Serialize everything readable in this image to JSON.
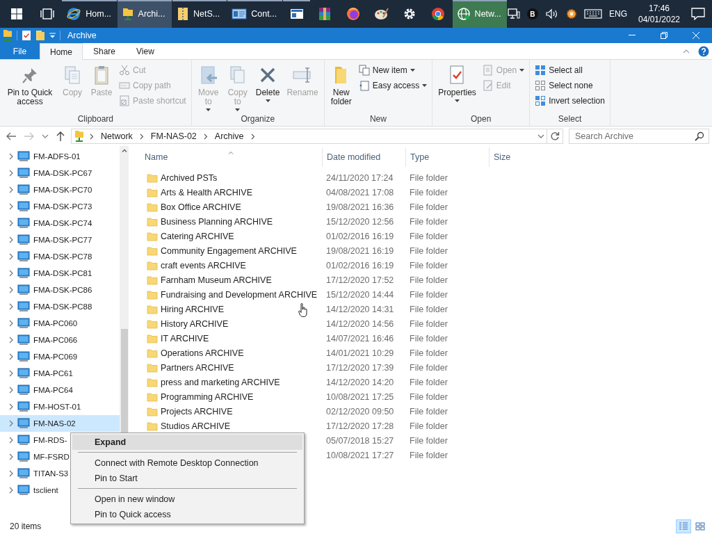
{
  "taskbar": {
    "apps": [
      {
        "kind": "start",
        "selected": false,
        "running": false
      },
      {
        "kind": "taskview",
        "selected": false,
        "running": false
      },
      {
        "kind": "ie",
        "label": "Hom...",
        "selected": false,
        "running": true
      },
      {
        "kind": "explorer",
        "label": "Archi...",
        "selected": true,
        "running": true
      },
      {
        "kind": "zip",
        "label": "NetS...",
        "selected": false,
        "running": true
      },
      {
        "kind": "card",
        "label": "Cont...",
        "selected": false,
        "running": true
      },
      {
        "kind": "window",
        "selected": false,
        "running": true
      },
      {
        "kind": "books",
        "selected": false,
        "running": false
      },
      {
        "kind": "firefox",
        "selected": false,
        "running": false
      },
      {
        "kind": "palette",
        "selected": false,
        "running": false
      },
      {
        "kind": "gear",
        "selected": false,
        "running": false
      },
      {
        "kind": "chrome",
        "selected": false,
        "running": false
      },
      {
        "kind": "globe",
        "label": "Netw...",
        "selected": false,
        "running": true,
        "attention": true
      }
    ],
    "tray": [
      {
        "kind": "monitor"
      },
      {
        "kind": "badge",
        "label": "B"
      },
      {
        "kind": "speaker"
      },
      {
        "kind": "cog"
      },
      {
        "kind": "keyboard"
      }
    ],
    "language": "ENG",
    "time": "17:46",
    "date": "04/01/2022"
  },
  "window": {
    "title": "Archive"
  },
  "ribbon": {
    "tabs": [
      {
        "label": "File",
        "kind": "file",
        "selected": false
      },
      {
        "label": "Home",
        "kind": "tab",
        "selected": true
      },
      {
        "label": "Share",
        "kind": "tab",
        "selected": false
      },
      {
        "label": "View",
        "kind": "tab",
        "selected": false
      }
    ],
    "groups": [
      {
        "label": "Clipboard",
        "controls": [
          {
            "kind": "large",
            "label": "Pin to Quick access",
            "disabled": false
          },
          {
            "kind": "large",
            "label": "Copy",
            "disabled": true
          },
          {
            "kind": "large",
            "label": "Paste",
            "disabled": true
          },
          {
            "kind": "stack",
            "items": [
              {
                "label": "Cut",
                "disabled": true
              },
              {
                "label": "Copy path",
                "disabled": true
              },
              {
                "label": "Paste shortcut",
                "disabled": true
              }
            ]
          }
        ]
      },
      {
        "label": "Organize",
        "controls": [
          {
            "kind": "large",
            "label": "Move to",
            "disabled": true,
            "dropdown": true
          },
          {
            "kind": "large",
            "label": "Copy to",
            "disabled": true,
            "dropdown": true
          },
          {
            "kind": "large",
            "label": "Delete",
            "disabled": false,
            "dropdown": true
          },
          {
            "kind": "large",
            "label": "Rename",
            "disabled": true
          }
        ]
      },
      {
        "label": "New",
        "controls": [
          {
            "kind": "large",
            "label": "New folder",
            "disabled": false
          },
          {
            "kind": "stack",
            "items": [
              {
                "label": "New item",
                "disabled": false,
                "dropdown": true
              },
              {
                "label": "Easy access",
                "disabled": false,
                "dropdown": true
              }
            ]
          }
        ]
      },
      {
        "label": "Open",
        "controls": [
          {
            "kind": "large",
            "label": "Properties",
            "disabled": false,
            "dropdown": true
          },
          {
            "kind": "stack",
            "items": [
              {
                "label": "Open",
                "disabled": true,
                "dropdown": true
              },
              {
                "label": "Edit",
                "disabled": true
              }
            ]
          }
        ]
      },
      {
        "label": "Select",
        "controls": [
          {
            "kind": "stack",
            "items": [
              {
                "label": "Select all",
                "disabled": false
              },
              {
                "label": "Select none",
                "disabled": false
              },
              {
                "label": "Invert selection",
                "disabled": false
              }
            ]
          }
        ]
      }
    ]
  },
  "address": {
    "crumbs": [
      "Network",
      "FM-NAS-02",
      "Archive"
    ],
    "search_placeholder": "Search Archive"
  },
  "sidebar": {
    "items": [
      {
        "label": "FM-ADFS-01",
        "selected": false,
        "expanded": false
      },
      {
        "label": "FMA-DSK-PC67",
        "selected": false,
        "expanded": false
      },
      {
        "label": "FMA-DSK-PC70",
        "selected": false,
        "expanded": false
      },
      {
        "label": "FMA-DSK-PC73",
        "selected": false,
        "expanded": false
      },
      {
        "label": "FMA-DSK-PC74",
        "selected": false,
        "expanded": false
      },
      {
        "label": "FMA-DSK-PC77",
        "selected": false,
        "expanded": false
      },
      {
        "label": "FMA-DSK-PC78",
        "selected": false,
        "expanded": false
      },
      {
        "label": "FMA-DSK-PC81",
        "selected": false,
        "expanded": false
      },
      {
        "label": "FMA-DSK-PC86",
        "selected": false,
        "expanded": false
      },
      {
        "label": "FMA-DSK-PC88",
        "selected": false,
        "expanded": false
      },
      {
        "label": "FMA-PC060",
        "selected": false,
        "expanded": false
      },
      {
        "label": "FMA-PC066",
        "selected": false,
        "expanded": false
      },
      {
        "label": "FMA-PC069",
        "selected": false,
        "expanded": false
      },
      {
        "label": "FMA-PC61",
        "selected": false,
        "expanded": false
      },
      {
        "label": "FMA-PC64",
        "selected": false,
        "expanded": false
      },
      {
        "label": "FM-HOST-01",
        "selected": false,
        "expanded": false
      },
      {
        "label": "FM-NAS-02",
        "selected": true,
        "expanded": false
      },
      {
        "label": "FM-RDS-",
        "selected": false,
        "expanded": false
      },
      {
        "label": "MF-FSRD",
        "selected": false,
        "expanded": false
      },
      {
        "label": "TITAN-S3",
        "selected": false,
        "expanded": false
      },
      {
        "label": "tsclient",
        "selected": false,
        "expanded": false
      }
    ]
  },
  "table": {
    "columns": [
      "Name",
      "Date modified",
      "Type",
      "Size"
    ],
    "rows": [
      {
        "name": "Archived PSTs",
        "date": "24/11/2020 17:24",
        "type": "File folder"
      },
      {
        "name": "Arts & Health ARCHIVE",
        "date": "04/08/2021 17:08",
        "type": "File folder"
      },
      {
        "name": "Box Office ARCHIVE",
        "date": "19/08/2021 16:36",
        "type": "File folder"
      },
      {
        "name": "Business Planning ARCHIVE",
        "date": "15/12/2020 12:56",
        "type": "File folder"
      },
      {
        "name": "Catering ARCHIVE",
        "date": "01/02/2016 16:19",
        "type": "File folder"
      },
      {
        "name": "Community Engagement ARCHIVE",
        "date": "19/08/2021 16:19",
        "type": "File folder"
      },
      {
        "name": "craft events ARCHIVE",
        "date": "01/02/2016 16:19",
        "type": "File folder"
      },
      {
        "name": "Farnham Museum ARCHIVE",
        "date": "17/12/2020 17:52",
        "type": "File folder"
      },
      {
        "name": "Fundraising and Development ARCHIVE",
        "date": "15/12/2020 14:44",
        "type": "File folder"
      },
      {
        "name": "Hiring ARCHIVE",
        "date": "14/12/2020 14:31",
        "type": "File folder"
      },
      {
        "name": "History ARCHIVE",
        "date": "14/12/2020 14:56",
        "type": "File folder"
      },
      {
        "name": "IT ARCHIVE",
        "date": "14/07/2021 16:46",
        "type": "File folder"
      },
      {
        "name": "Operations ARCHIVE",
        "date": "14/01/2021 10:29",
        "type": "File folder"
      },
      {
        "name": "Partners ARCHIVE",
        "date": "17/12/2020 17:39",
        "type": "File folder"
      },
      {
        "name": "press and marketing ARCHIVE",
        "date": "14/12/2020 14:20",
        "type": "File folder"
      },
      {
        "name": "Programming ARCHIVE",
        "date": "10/08/2021 17:25",
        "type": "File folder"
      },
      {
        "name": "Projects ARCHIVE",
        "date": "02/12/2020 09:50",
        "type": "File folder"
      },
      {
        "name": "Studios ARCHIVE",
        "date": "17/12/2020 17:28",
        "type": "File folder"
      },
      {
        "date": "05/07/2018 15:27",
        "type": "File folder"
      },
      {
        "date": "10/08/2021 17:27",
        "type": "File folder"
      }
    ]
  },
  "context_menu": {
    "items": [
      {
        "kind": "item",
        "label": "Expand",
        "default": true,
        "selected": true
      },
      {
        "kind": "separator"
      },
      {
        "kind": "item",
        "label": "Connect with Remote Desktop Connection",
        "default": false,
        "selected": false
      },
      {
        "kind": "item",
        "label": "Pin to Start",
        "default": false,
        "selected": false
      },
      {
        "kind": "separator"
      },
      {
        "kind": "item",
        "label": "Open in new window",
        "default": false,
        "selected": false
      },
      {
        "kind": "item",
        "label": "Pin to Quick access",
        "default": false,
        "selected": false
      }
    ]
  },
  "status_bar": {
    "count": "20 items",
    "views": [
      {
        "kind": "details",
        "selected": true
      },
      {
        "kind": "tiles",
        "selected": false
      }
    ]
  }
}
